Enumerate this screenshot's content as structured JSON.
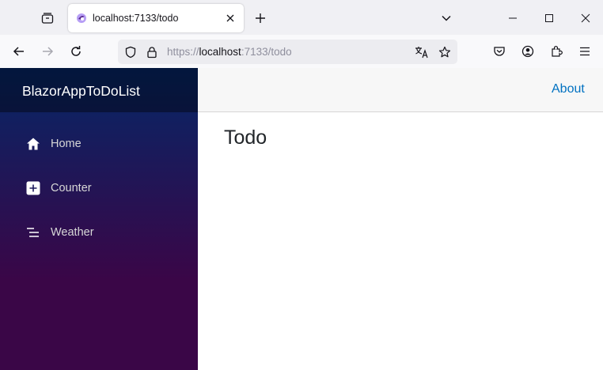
{
  "browser": {
    "tab": {
      "title": "localhost:7133/todo"
    },
    "url": {
      "scheme": "https://",
      "host": "localhost",
      "rest": ":7133/todo"
    },
    "icons": {
      "tab_list": "tab-list-icon",
      "favicon": "blazor-favicon",
      "close_tab": "close-icon",
      "new_tab": "plus-icon",
      "list_all_tabs": "chevron-down-icon",
      "minimize": "minimize-icon",
      "maximize": "maximize-icon",
      "close_window": "close-icon",
      "back": "back-arrow-icon",
      "forward": "forward-arrow-icon",
      "reload": "reload-icon",
      "tracking_protection": "shield-icon",
      "lock": "lock-icon",
      "translate": "translate-icon",
      "bookmark": "star-icon",
      "pocket": "pocket-icon",
      "account": "account-icon",
      "extensions": "puzzle-icon",
      "menu": "hamburger-icon"
    }
  },
  "app": {
    "brand": "BlazorAppToDoList",
    "nav": [
      {
        "label": "Home",
        "icon": "house-icon"
      },
      {
        "label": "Counter",
        "icon": "plus-square-icon"
      },
      {
        "label": "Weather",
        "icon": "list-icon"
      }
    ],
    "top_link": "About",
    "page_title": "Todo",
    "colors": {
      "sidebar_top": "#052767",
      "sidebar_bottom": "#3a0647",
      "link": "#0071c1"
    }
  }
}
